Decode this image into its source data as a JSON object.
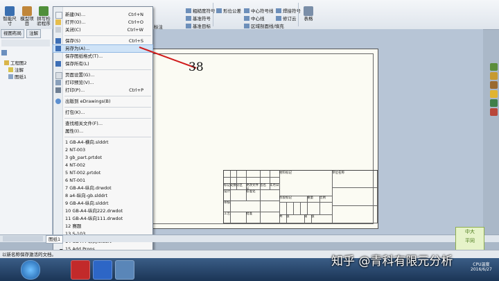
{
  "ribbon": {
    "left_buttons": [
      {
        "label": "智能尺寸",
        "icon": "smart-dimension-icon"
      },
      {
        "label": "模型项目",
        "icon": "model-items-icon"
      },
      {
        "label": "拼写检验程序",
        "icon": "spell-check-icon"
      }
    ],
    "annotation_row1": [
      "粗糙度符号",
      "形位公差",
      "中心符号线",
      "焊接符号"
    ],
    "annotation_row2": [
      "基准符号",
      "中心线",
      "修订云"
    ],
    "annotation_row3": [
      "基准目标",
      "区域剖面线/填充"
    ],
    "left_fragments": [
      "标注"
    ],
    "table_label": "表格"
  },
  "left_panel": {
    "tabs": [
      "视图布局",
      "注解"
    ],
    "tree": [
      {
        "label": "工程图2",
        "icon": "drawing-icon"
      },
      {
        "label": "注解",
        "icon": "annotation-icon"
      },
      {
        "label": "图纸1",
        "icon": "sheet-icon"
      }
    ]
  },
  "file_menu": {
    "items": [
      {
        "label": "新建(N)...",
        "shortcut": "Ctrl+N",
        "icon": "new-file-icon"
      },
      {
        "label": "打开(O)...",
        "shortcut": "Ctrl+O",
        "icon": "open-folder-icon"
      },
      {
        "label": "关闭(C)",
        "shortcut": "Ctrl+W",
        "icon": "close-doc-icon"
      },
      {
        "label": "保存(S)",
        "shortcut": "Ctrl+S",
        "icon": "save-icon"
      },
      {
        "label": "另存为(A)...",
        "shortcut": "",
        "icon": "save-as-icon",
        "highlighted": true
      },
      {
        "label": "保存图纸格式(T)...",
        "shortcut": "",
        "icon": ""
      },
      {
        "label": "保存所有(L)",
        "shortcut": "",
        "icon": "save-all-icon"
      },
      {
        "label": "页面设置(G)...",
        "shortcut": "",
        "icon": "page-setup-icon"
      },
      {
        "label": "打印预览(V)...",
        "shortcut": "",
        "icon": "print-preview-icon"
      },
      {
        "label": "打印(P)...",
        "shortcut": "Ctrl+P",
        "icon": "print-icon"
      },
      {
        "label": "出版到 eDrawings(B)",
        "shortcut": "",
        "icon": "edrawings-icon"
      },
      {
        "label": "打包(K)...",
        "shortcut": "",
        "icon": ""
      },
      {
        "label": "查找相关文件(F)...",
        "shortcut": "",
        "icon": ""
      },
      {
        "label": "属性(I)...",
        "shortcut": "",
        "icon": ""
      }
    ],
    "recent_files": [
      "1 GB-A4-横向.slddrt",
      "2 NT-003",
      "3 gb_part.prtdot",
      "4 NT-002",
      "5 NT-002.prtdot",
      "6 NT-001",
      "7 GB-A4-纵向.drwdot",
      "8 a4-纵向-gb.slddrt",
      "9 GB-A4-纵向.slddrt",
      "10 GB-A4-纵向222.drwdot",
      "11 GB-A4-纵向111.drwdot",
      "12 赛题",
      "13 S-103",
      "14 GB-A4-纵向.slddrt",
      "15 Add Props"
    ]
  },
  "annotation": {
    "number": "38",
    "color": "#d01c1c"
  },
  "title_block": {
    "cells": [
      "标记",
      "处数",
      "分区",
      "更改文件号",
      "签名",
      "年月日",
      "设计",
      "标准化",
      "阶段标记",
      "重量",
      "比例",
      "审核",
      "工艺",
      "批准",
      "共",
      "张",
      "第",
      "张",
      "材料标记",
      "单位名称"
    ]
  },
  "sheet_tabs": [
    "图纸1"
  ],
  "status": {
    "text": "以新名称保存激活的文档。"
  },
  "taskbar": {
    "apps": [
      "start-orb",
      "solidworks-app",
      "wps-writer-app",
      "browser-app"
    ]
  },
  "watermark": "知乎 @青科有限元分析",
  "tray": {
    "label": "CPU温度",
    "date": "2016/6/27"
  },
  "stamp": {
    "line1": "中大",
    "line2": "平同"
  }
}
